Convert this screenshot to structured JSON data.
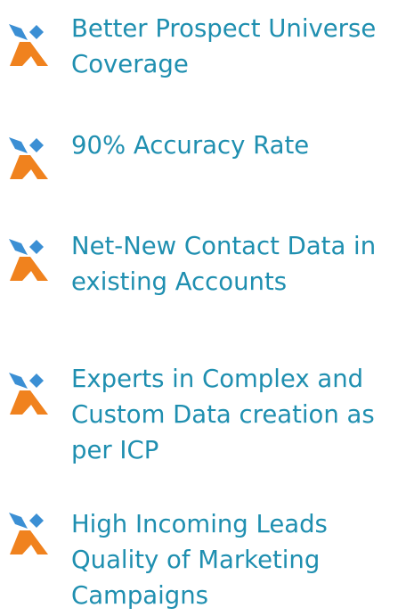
{
  "brand": {
    "icon_name": "brand-x-logo-icon",
    "text_color": "#1f8fb0",
    "icon_blue": "#3b8fd4",
    "icon_orange": "#f0821e"
  },
  "features": [
    {
      "lines": [
        "Better Prospect Universe",
        "Coverage"
      ]
    },
    {
      "lines": [
        "90% Accuracy Rate"
      ]
    },
    {
      "lines": [
        "Net-New Contact Data in",
        "existing Accounts"
      ]
    },
    {
      "lines": [
        "Experts in Complex and",
        "Custom Data creation as",
        "per ICP"
      ]
    },
    {
      "lines": [
        "High Incoming Leads",
        "Quality of Marketing",
        "Campaigns"
      ]
    }
  ]
}
